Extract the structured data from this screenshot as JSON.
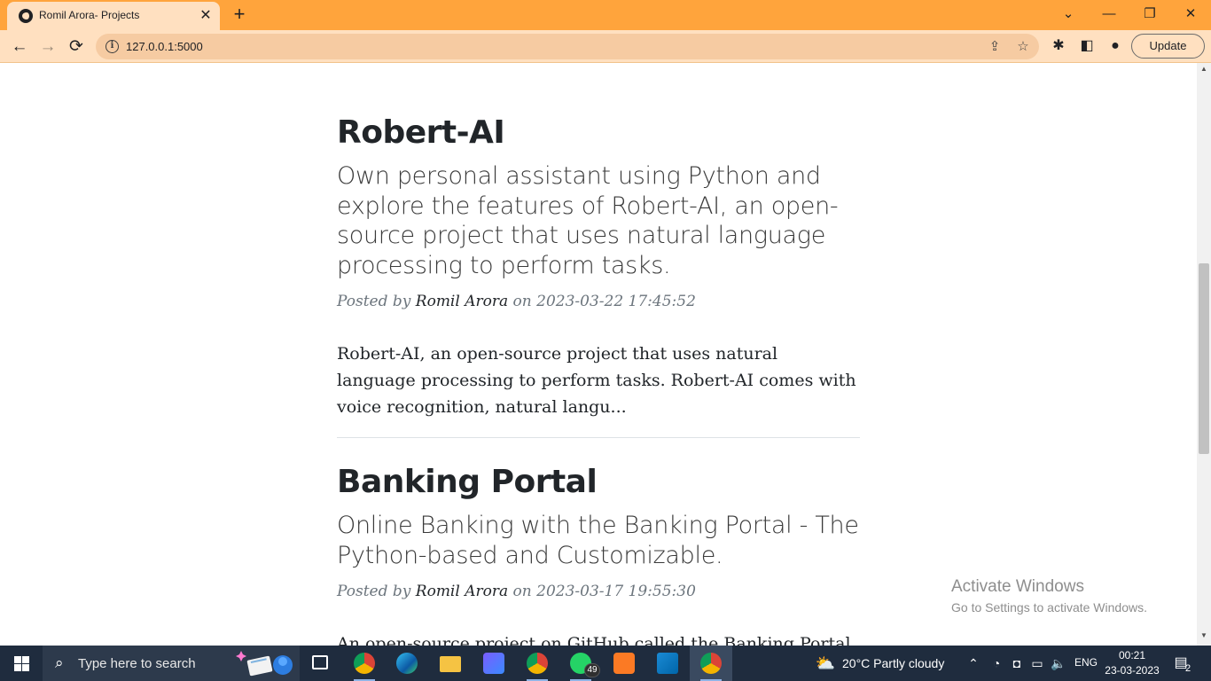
{
  "browser": {
    "tab_title": "Romil Arora- Projects",
    "url": "127.0.0.1:5000",
    "update_label": "Update"
  },
  "posts": [
    {
      "title": "Robert-AI",
      "subtitle": "Own personal assistant using Python and explore the features of Robert-AI, an open-source project that uses natural language processing to perform tasks.",
      "meta_prefix": "Posted by ",
      "author": "Romil Arora",
      "meta_on": " on ",
      "date": "2023-03-22 17:45:52",
      "excerpt": "Robert-AI, an open-source project that uses natural language processing to perform tasks. Robert-AI comes with voice recognition, natural langu..."
    },
    {
      "title": "Banking Portal",
      "subtitle": "Online Banking with the Banking Portal - The Python-based and Customizable.",
      "meta_prefix": "Posted by ",
      "author": "Romil Arora",
      "meta_on": " on ",
      "date": "2023-03-17 19:55:30",
      "excerpt": "An open-source project on GitHub called the Banking Portal"
    }
  ],
  "watermark": {
    "line1": "Activate Windows",
    "line2": "Go to Settings to activate Windows."
  },
  "taskbar": {
    "search_placeholder": "Type here to search",
    "whatsapp_badge": "49",
    "weather": "20°C  Partly cloudy",
    "language": "ENG",
    "time": "00:21",
    "date": "23-03-2023",
    "notifications": "2"
  }
}
